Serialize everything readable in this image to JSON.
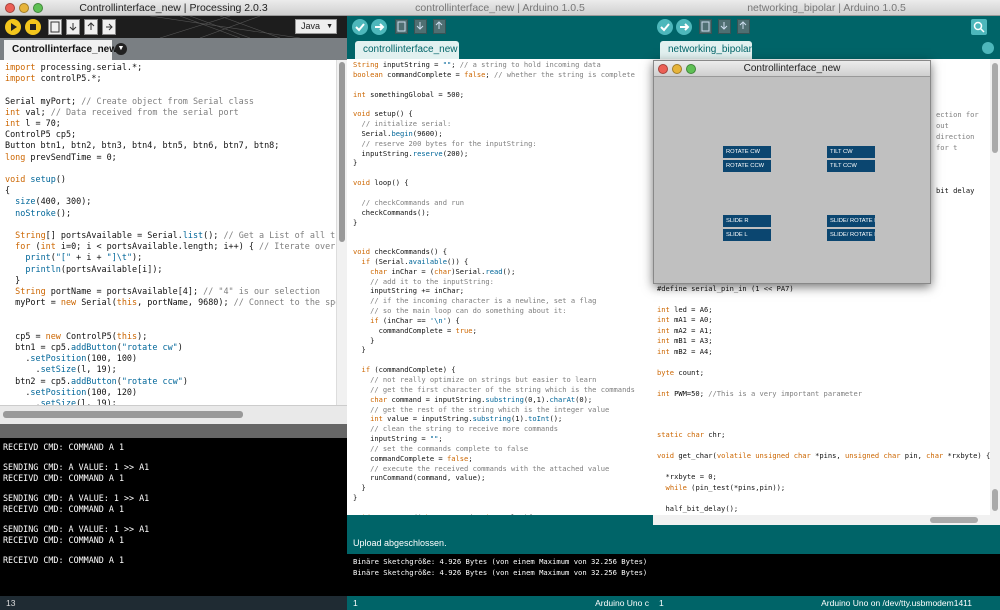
{
  "processing": {
    "title": "Controllinterface_new | Processing 2.0.3",
    "mode": "Java",
    "tab": "Controllinterface_new",
    "code": [
      [
        "import processing.serial.*;"
      ],
      [
        "import controlP5.*;"
      ],
      [
        ""
      ],
      [
        "Serial myPort; // Create object from Serial class"
      ],
      [
        "int val; // Data received from the serial port"
      ],
      [
        "int l = 70;"
      ],
      [
        "ControlP5 cp5;"
      ],
      [
        "Button btn1, btn2, btn3, btn4, btn5, btn6, btn7, btn8;"
      ],
      [
        "long prevSendTime = 0;"
      ],
      [
        ""
      ],
      [
        "void setup()"
      ],
      [
        "{"
      ],
      [
        "  size(400, 300);"
      ],
      [
        "  noStroke();"
      ],
      [
        ""
      ],
      [
        "  String[] portsAvailable = Serial.list(); // Get a List of all the"
      ],
      [
        "  for (int i=0; i < portsAvailable.length; i++) { // Iterate over th"
      ],
      [
        "    print(\"[\" + i + \"]\\t\");"
      ],
      [
        "    println(portsAvailable[i]);"
      ],
      [
        "  }"
      ],
      [
        "  String portName = portsAvailable[4]; // \"4\" is our selection"
      ],
      [
        "  myPort = new Serial(this, portName, 9680); // Connect to the speci"
      ],
      [
        ""
      ],
      [
        ""
      ],
      [
        "  cp5 = new ControlP5(this);"
      ],
      [
        "  btn1 = cp5.addButton(\"rotate cw\")"
      ],
      [
        "    .setPosition(100, 100)"
      ],
      [
        "      .setSize(l, 19);"
      ],
      [
        "  btn2 = cp5.addButton(\"rotate ccw\")"
      ],
      [
        "    .setPosition(100, 120)"
      ],
      [
        "      .setSize(l, 19);"
      ]
    ],
    "console": [
      "RECEIVD CMD: COMMAND A 1",
      "",
      "SENDING CMD: A VALUE: 1 >> A1",
      "RECEIVD CMD: COMMAND A 1",
      "",
      "SENDING CMD: A VALUE: 1 >> A1",
      "RECEIVD CMD: COMMAND A 1",
      "",
      "SENDING CMD: A VALUE: 1 >> A1",
      "RECEIVD CMD: COMMAND A 1",
      "",
      "RECEIVD CMD: COMMAND A 1"
    ],
    "status": "13"
  },
  "arduino1": {
    "title": "controllinterface_new | Arduino 1.0.5",
    "tab": "controllinterface_new",
    "code": [
      "String inputString = \"\"; // a string to hold incoming data",
      "boolean commandComplete = false; // whether the string is complete",
      "",
      "int somethingGlobal = 500;",
      "",
      "void setup() {",
      "  // initialize serial:",
      "  Serial.begin(9600);",
      "  // reserve 200 bytes for the inputString:",
      "  inputString.reserve(200);",
      "}",
      "",
      "void loop() {",
      "",
      "  // checkCommands and run",
      "  checkCommands();",
      "}",
      "",
      "",
      "void checkCommands() {",
      "  if (Serial.available()) {",
      "    char inChar = (char)Serial.read();",
      "    // add it to the inputString:",
      "    inputString += inChar;",
      "    // if the incoming character is a newline, set a flag",
      "    // so the main loop can do something about it:",
      "    if (inChar == '\\n') {",
      "      commandComplete = true;",
      "    }",
      "  }",
      "",
      "  if (commandComplete) {",
      "    // not really optimize on strings but easier to learn",
      "    // get the first character of the string which is the commands",
      "    char command = inputString.substring(0,1).charAt(0);",
      "    // get the rest of the string which is the integer value",
      "    int value = inputString.substring(1).toInt();",
      "    // clean the string to receive more commands",
      "    inputString = \"\";",
      "    // set the commands complete to false",
      "    commandComplete = false;",
      "    // execute the received commands with the attached value",
      "    runCommand(command, value);",
      "  }",
      "}",
      "",
      "void runCommand(char commands, int value){"
    ],
    "upload_status": "Upload abgeschlossen.",
    "console": [
      "Binäre Sketchgröße: 4.926 Bytes (von einem Maximum von 32.256 Bytes)",
      "Binäre Sketchgröße: 4.926 Bytes (von einem Maximum von 32.256 Bytes)"
    ],
    "status_line": "1",
    "status_board": "Arduino Uno c"
  },
  "arduino2": {
    "title": "networking_bipolar | Arduino 1.0.5",
    "tab": "networking_bipolar",
    "hidden_text": [
      "ection for out",
      "direction for t",
      "bit delay"
    ],
    "code": [
      "#define serial_pin_in (1 << PA7)",
      "",
      "int led = A6;",
      "int mA1 = A0;",
      "int mA2 = A1;",
      "int mB1 = A3;",
      "int mB2 = A4;",
      "",
      "byte count;",
      "",
      "int PWM=50; //This is a very important parameter",
      "",
      "",
      "",
      "static char chr;",
      "",
      "void get_char(volatile unsigned char *pins, unsigned char pin, char *rxbyte) {",
      "",
      "  *rxbyte = 0;",
      "  while (pin_test(*pins,pin));",
      "",
      "  half_bit_delay();",
      "  bit_delay();"
    ],
    "status_line": "1",
    "status_board": "Arduino Uno on /dev/tty.usbmodem1411"
  },
  "sketch": {
    "title": "Controllinterface_new",
    "buttons": {
      "rotate_cw": "ROTATE CW",
      "rotate_ccw": "ROTATE CCW",
      "tilt_cw": "TILT CW",
      "tilt_ccw": "TILT CCW",
      "slide_r": "SLIDE R",
      "slide_l": "SLIDE L",
      "slide_rotate_r": "SLIDE/ ROTATE R",
      "slide_rotate_l": "SLIDE/ ROTATE L"
    }
  },
  "colors": {
    "arduino_teal": "#006468",
    "arduino_tab": "#e2f1f0",
    "processing_bg": "#1d1d1d",
    "sketch_bg": "#c0c0c0",
    "button": "#0b4670"
  }
}
